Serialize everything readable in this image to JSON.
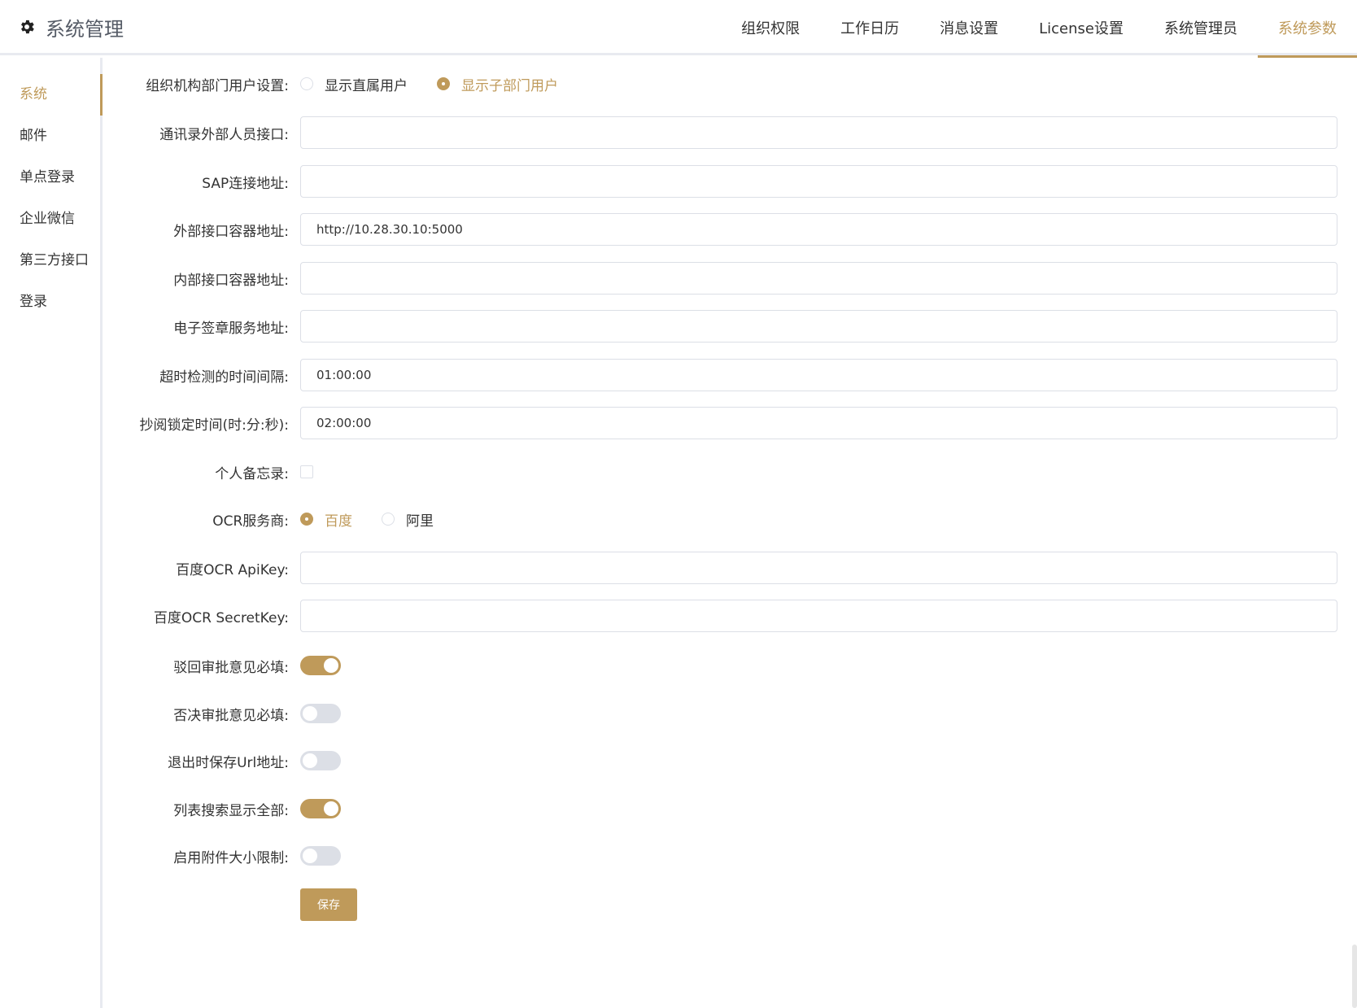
{
  "app": {
    "title": "系统管理",
    "icon": "gear-icon"
  },
  "topnav": [
    {
      "label": "组织权限",
      "active": false
    },
    {
      "label": "工作日历",
      "active": false
    },
    {
      "label": "消息设置",
      "active": false
    },
    {
      "label": "License设置",
      "active": false
    },
    {
      "label": "系统管理员",
      "active": false
    },
    {
      "label": "系统参数",
      "active": true
    }
  ],
  "sidebar": [
    {
      "label": "系统",
      "active": true
    },
    {
      "label": "邮件",
      "active": false
    },
    {
      "label": "单点登录",
      "active": false
    },
    {
      "label": "企业微信",
      "active": false
    },
    {
      "label": "第三方接口",
      "active": false
    },
    {
      "label": "登录",
      "active": false
    }
  ],
  "form": {
    "org_user": {
      "label": "组织机构部门用户设置:",
      "options": [
        "显示直属用户",
        "显示子部门用户"
      ],
      "selected": 1
    },
    "contacts_api": {
      "label": "通讯录外部人员接口:",
      "value": ""
    },
    "sap_url": {
      "label": "SAP连接地址:",
      "value": ""
    },
    "ext_container": {
      "label": "外部接口容器地址:",
      "value": "http://10.28.30.10:5000"
    },
    "int_container": {
      "label": "内部接口容器地址:",
      "value": ""
    },
    "esign_url": {
      "label": "电子签章服务地址:",
      "value": ""
    },
    "timeout_interval": {
      "label": "超时检测的时间间隔:",
      "value": "01:00:00"
    },
    "lock_time": {
      "label": "抄阅锁定时间(时:分:秒):",
      "value": "02:00:00"
    },
    "memo": {
      "label": "个人备忘录:",
      "checked": false
    },
    "ocr_provider": {
      "label": "OCR服务商:",
      "options": [
        "百度",
        "阿里"
      ],
      "selected": 0
    },
    "ocr_apikey": {
      "label": "百度OCR ApiKey:",
      "value": ""
    },
    "ocr_secretkey": {
      "label": "百度OCR SecretKey:",
      "value": ""
    },
    "reject_required": {
      "label": "驳回审批意见必填:",
      "on": true
    },
    "deny_required": {
      "label": "否决审批意见必填:",
      "on": false
    },
    "save_url_on_exit": {
      "label": "退出时保存Url地址:",
      "on": false
    },
    "list_search_all": {
      "label": "列表搜索显示全部:",
      "on": true
    },
    "attachment_limit": {
      "label": "启用附件大小限制:",
      "on": false
    },
    "save_label": "保存"
  },
  "colors": {
    "accent": "#bf9a5a",
    "border": "#dcdfe6",
    "divider": "#e8eaf0"
  }
}
